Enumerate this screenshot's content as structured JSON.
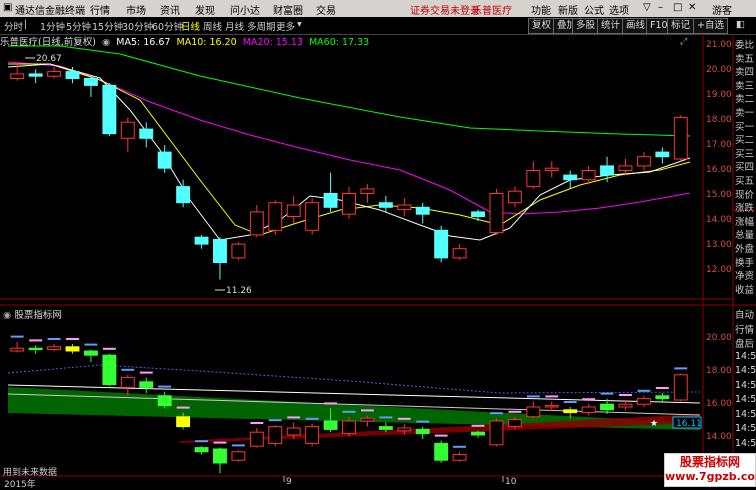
{
  "menubar": {
    "app_name": "通达信金融终端",
    "menus": [
      "行情",
      "市场",
      "资讯",
      "发现",
      "问小达",
      "财富圈",
      "交易"
    ],
    "login_notice": "证券交易未登录",
    "stock_tag": "乐普医疗",
    "right_menus": [
      "功能",
      "新版",
      "公式",
      "选项"
    ],
    "guest": "游客"
  },
  "toolbar": {
    "periods": [
      "分时",
      "1分钟",
      "5分钟",
      "15分钟",
      "30分钟",
      "60分钟",
      "日线",
      "周线",
      "月线",
      "多周期",
      "更多"
    ],
    "selected": "日线",
    "buttons": [
      "复权",
      "叠加",
      "多股",
      "统计",
      "画线",
      "F10",
      "标记",
      "+自选"
    ]
  },
  "chart_header": {
    "stock": "乐普医疗(日线,前复权)",
    "ma5": "MA5: 16.67",
    "ma10": "MA10: 16.20",
    "ma20": "MA20: 15.13",
    "ma60": "MA60: 17.33",
    "colors": {
      "ma5": "#ffffff",
      "ma10": "#ffff00",
      "ma20": "#ff00ff",
      "ma60": "#00ff00"
    }
  },
  "price_axis": [
    "21.00",
    "20.00",
    "19.00",
    "18.00",
    "17.00",
    "16.00",
    "15.00",
    "14.00",
    "13.00",
    "12.00"
  ],
  "annotations": {
    "high": "20.67",
    "low": "11.26"
  },
  "indicator": {
    "title": "股票指标网",
    "axis": [
      "20.00",
      "18.00",
      "16.00",
      "14.00"
    ],
    "current": "16.11",
    "no_data": "用到未来数据"
  },
  "date_axis": {
    "year": "2015年",
    "m9": "9",
    "m10": "10"
  },
  "right_panel": [
    "委比",
    "卖五",
    "卖四",
    "卖三",
    "卖二",
    "卖一",
    "买一",
    "买二",
    "买三",
    "买四",
    "买五",
    "现价",
    "涨跌",
    "涨幅",
    "总量",
    "外盘",
    "换手",
    "净资",
    "收益"
  ],
  "right_panel_lower": [
    "自动",
    "行情",
    "盘后",
    "14:50",
    "14:50",
    "14:50",
    "14:50",
    "14:50",
    "14:50",
    "14:50",
    "14:50"
  ],
  "watermark": {
    "cn": "股票指标网",
    "url": "www.7gpzb.com"
  },
  "chart_data": {
    "type": "candlestick",
    "title": "乐普医疗(日线,前复权)",
    "ylim": [
      11.5,
      21.5
    ],
    "candles": [
      {
        "o": 20.0,
        "c": 20.2,
        "h": 20.67,
        "l": 19.9,
        "up": true
      },
      {
        "o": 20.2,
        "c": 20.1,
        "h": 20.4,
        "l": 19.8,
        "up": false
      },
      {
        "o": 20.1,
        "c": 20.3,
        "h": 20.5,
        "l": 20.0,
        "up": true
      },
      {
        "o": 20.3,
        "c": 20.0,
        "h": 20.5,
        "l": 19.8,
        "up": false
      },
      {
        "o": 20.0,
        "c": 19.7,
        "h": 20.1,
        "l": 19.2,
        "up": false
      },
      {
        "o": 19.7,
        "c": 17.6,
        "h": 19.8,
        "l": 17.5,
        "up": false
      },
      {
        "o": 17.4,
        "c": 18.1,
        "h": 18.3,
        "l": 16.8,
        "up": true
      },
      {
        "o": 17.8,
        "c": 17.4,
        "h": 18.1,
        "l": 17.0,
        "up": false
      },
      {
        "o": 16.8,
        "c": 16.1,
        "h": 17.1,
        "l": 15.9,
        "up": false
      },
      {
        "o": 15.3,
        "c": 14.6,
        "h": 15.6,
        "l": 14.4,
        "up": false
      },
      {
        "o": 13.1,
        "c": 12.8,
        "h": 13.2,
        "l": 12.6,
        "up": false
      },
      {
        "o": 13.0,
        "c": 12.0,
        "h": 13.1,
        "l": 11.26,
        "up": false
      },
      {
        "o": 12.2,
        "c": 12.8,
        "h": 12.9,
        "l": 12.1,
        "up": true
      },
      {
        "o": 13.2,
        "c": 14.2,
        "h": 14.5,
        "l": 13.1,
        "up": true
      },
      {
        "o": 13.4,
        "c": 14.6,
        "h": 14.7,
        "l": 13.2,
        "up": true
      },
      {
        "o": 14.0,
        "c": 14.5,
        "h": 14.9,
        "l": 13.7,
        "up": true
      },
      {
        "o": 13.4,
        "c": 14.6,
        "h": 14.8,
        "l": 13.2,
        "up": true
      },
      {
        "o": 15.0,
        "c": 14.4,
        "h": 15.9,
        "l": 14.2,
        "up": false
      },
      {
        "o": 14.1,
        "c": 15.0,
        "h": 15.3,
        "l": 13.9,
        "up": true
      },
      {
        "o": 15.0,
        "c": 15.2,
        "h": 15.4,
        "l": 14.6,
        "up": true
      },
      {
        "o": 14.6,
        "c": 14.4,
        "h": 14.9,
        "l": 14.2,
        "up": false
      },
      {
        "o": 14.3,
        "c": 14.5,
        "h": 14.8,
        "l": 14.0,
        "up": true
      },
      {
        "o": 14.4,
        "c": 14.1,
        "h": 14.6,
        "l": 13.7,
        "up": false
      },
      {
        "o": 13.4,
        "c": 12.2,
        "h": 13.6,
        "l": 12.0,
        "up": false
      },
      {
        "o": 12.2,
        "c": 12.6,
        "h": 12.8,
        "l": 12.1,
        "up": true
      },
      {
        "o": 14.2,
        "c": 14.0,
        "h": 14.3,
        "l": 13.8,
        "up": false
      },
      {
        "o": 13.3,
        "c": 15.0,
        "h": 15.2,
        "l": 13.2,
        "up": true
      },
      {
        "o": 14.6,
        "c": 15.1,
        "h": 15.3,
        "l": 14.4,
        "up": true
      },
      {
        "o": 15.3,
        "c": 16.0,
        "h": 16.4,
        "l": 15.2,
        "up": true
      },
      {
        "o": 16.0,
        "c": 16.1,
        "h": 16.4,
        "l": 15.7,
        "up": true
      },
      {
        "o": 15.8,
        "c": 15.6,
        "h": 16.0,
        "l": 15.2,
        "up": false
      },
      {
        "o": 15.6,
        "c": 16.0,
        "h": 16.2,
        "l": 15.4,
        "up": true
      },
      {
        "o": 16.2,
        "c": 15.8,
        "h": 16.6,
        "l": 15.5,
        "up": false
      },
      {
        "o": 16.0,
        "c": 16.2,
        "h": 16.5,
        "l": 15.8,
        "up": true
      },
      {
        "o": 16.2,
        "c": 16.6,
        "h": 16.8,
        "l": 16.0,
        "up": true
      },
      {
        "o": 16.6,
        "c": 16.8,
        "h": 17.0,
        "l": 16.3,
        "up": false
      },
      {
        "o": 16.5,
        "c": 18.3,
        "h": 18.4,
        "l": 16.4,
        "up": true
      }
    ]
  }
}
